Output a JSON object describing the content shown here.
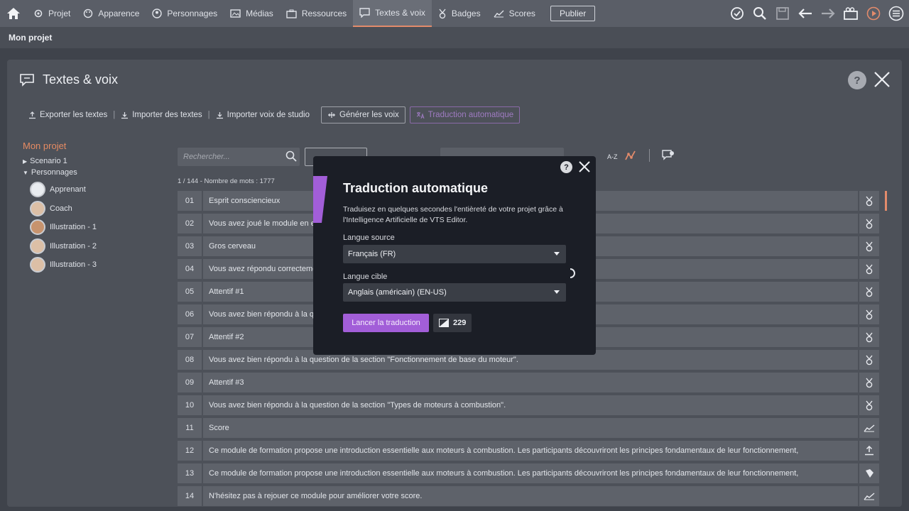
{
  "nav": {
    "items": [
      {
        "label": "Projet",
        "icon": "gear-icon"
      },
      {
        "label": "Apparence",
        "icon": "palette-icon"
      },
      {
        "label": "Personnages",
        "icon": "person-icon"
      },
      {
        "label": "Médias",
        "icon": "media-icon"
      },
      {
        "label": "Ressources",
        "icon": "briefcase-icon"
      },
      {
        "label": "Textes & voix",
        "icon": "speech-icon",
        "active": true
      },
      {
        "label": "Badges",
        "icon": "badge-icon"
      },
      {
        "label": "Scores",
        "icon": "chart-icon"
      }
    ],
    "publish_label": "Publier"
  },
  "project_name": "Mon projet",
  "panel": {
    "title": "Textes & voix",
    "help": "?",
    "toolbar": {
      "export": "Exporter les textes",
      "import": "Importer des textes",
      "import_voice": "Importer voix de studio",
      "generate": "Générer les voix",
      "auto_translate": "Traduction automatique"
    }
  },
  "sidebar": {
    "project": "Mon projet",
    "scenario": "Scenario 1",
    "characters_heading": "Personnages",
    "characters": [
      "Apprenant",
      "Coach",
      "Illustration - 1",
      "Illustration - 2",
      "Illustration - 3"
    ]
  },
  "search": {
    "placeholder": "Rechercher..."
  },
  "sort_az": "A-Z",
  "count_text": "1 / 144 - Nombre de mots : 1777",
  "rows": [
    {
      "num": "01",
      "text": "Esprit consciencieux",
      "icon": "badge"
    },
    {
      "num": "02",
      "text": "Vous avez joué le module en entier",
      "icon": "badge"
    },
    {
      "num": "03",
      "text": "Gros cerveau",
      "icon": "badge"
    },
    {
      "num": "04",
      "text": "Vous avez répondu correctement",
      "icon": "badge"
    },
    {
      "num": "05",
      "text": "Attentif #1",
      "icon": "badge"
    },
    {
      "num": "06",
      "text": "Vous avez bien répondu à la question",
      "icon": "badge"
    },
    {
      "num": "07",
      "text": "Attentif #2",
      "icon": "badge"
    },
    {
      "num": "08",
      "text": "Vous avez bien répondu à la question de la section \"Fonctionnement de base du moteur\".",
      "icon": "badge"
    },
    {
      "num": "09",
      "text": "Attentif #3",
      "icon": "badge"
    },
    {
      "num": "10",
      "text": "Vous avez bien répondu à la question de la section \"Types de moteurs à combustion\".",
      "icon": "badge"
    },
    {
      "num": "11",
      "text": "Score",
      "icon": "chart"
    },
    {
      "num": "12",
      "text": "Ce module de formation propose une introduction essentielle aux moteurs à combustion. Les participants découvriront les principes fondamentaux de leur fonctionnement,",
      "icon": "upload"
    },
    {
      "num": "13",
      "text": "Ce module de formation propose une introduction essentielle aux moteurs à combustion. Les participants découvriront les principes fondamentaux de leur fonctionnement,",
      "icon": "flag"
    },
    {
      "num": "14",
      "text": "N'hésitez pas à rejouer ce module pour améliorer votre score.",
      "icon": "chart"
    }
  ],
  "modal": {
    "title": "Traduction automatique",
    "help": "?",
    "description": "Traduisez en quelques secondes l'entièreté de votre projet grâce à l'Intelligence Artificielle de VTS Editor.",
    "source_label": "Langue source",
    "source_value": "Français (FR)",
    "target_label": "Langue cible",
    "target_value": "Anglais (américain) (EN-US)",
    "launch_label": "Lancer la traduction",
    "credits": "229"
  },
  "colors": {
    "accent_orange": "#e38b6b",
    "accent_purple": "#a25ed8",
    "modal_bg": "#1b1e26"
  }
}
